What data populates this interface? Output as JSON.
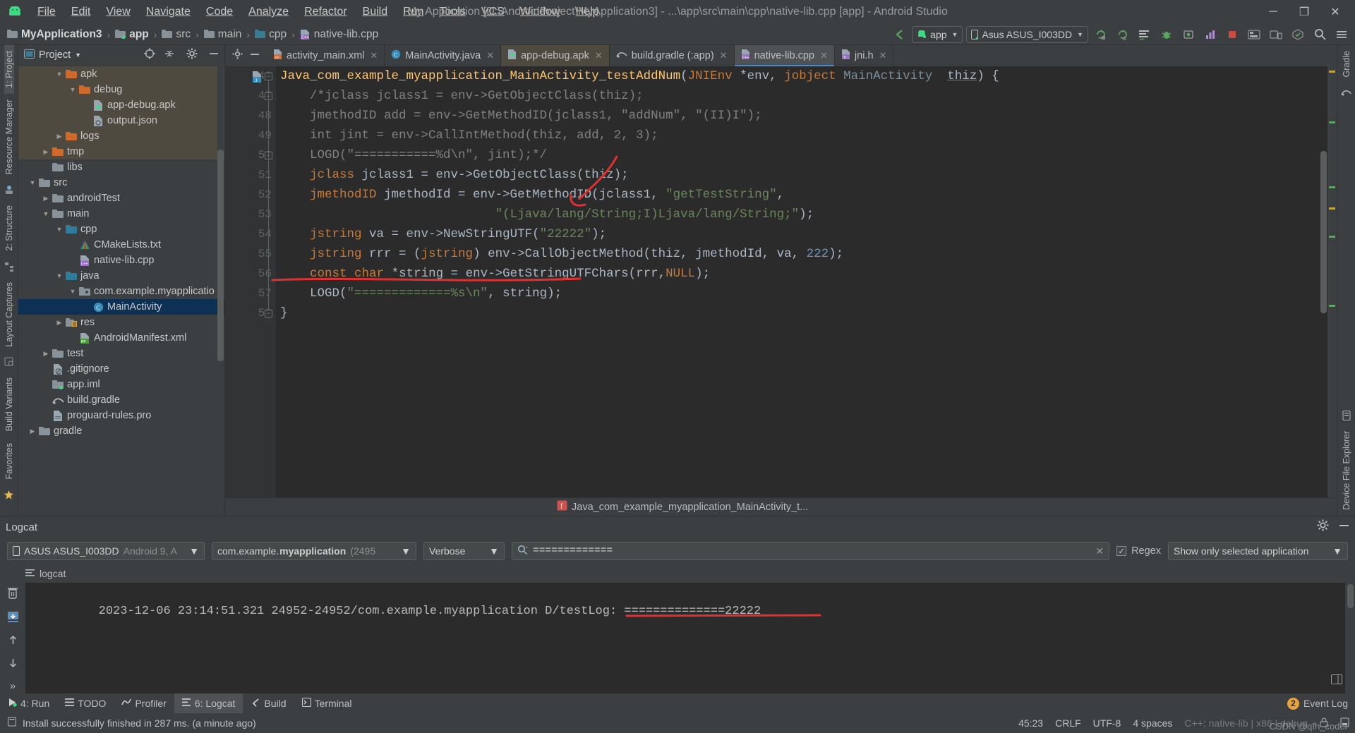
{
  "window": {
    "title": "My Application [D:\\AndroidProject\\MyApplication3] - ...\\app\\src\\main\\cpp\\native-lib.cpp [app] - Android Studio",
    "minimize": "─",
    "maximize": "❐",
    "close": "✕"
  },
  "menu": {
    "items": [
      {
        "label": "File"
      },
      {
        "label": "Edit"
      },
      {
        "label": "View"
      },
      {
        "label": "Navigate"
      },
      {
        "label": "Code"
      },
      {
        "label": "Analyze"
      },
      {
        "label": "Refactor"
      },
      {
        "label": "Build"
      },
      {
        "label": "Run"
      },
      {
        "label": "Tools"
      },
      {
        "label": "VCS"
      },
      {
        "label": "Window"
      },
      {
        "label": "Help"
      }
    ]
  },
  "breadcrumb": {
    "items": [
      "MyApplication3",
      "app",
      "src",
      "main",
      "cpp",
      "native-lib.cpp"
    ],
    "separator": "›"
  },
  "toolbar": {
    "run_config": "app",
    "device": "Asus ASUS_I003DD",
    "icons": [
      "back-arrow-icon",
      "sync-gradle-icon",
      "avd-manager-icon",
      "sdk-manager-icon",
      "run-icon",
      "debug-icon",
      "attach-debugger-icon",
      "profiler-icon",
      "stop-icon",
      "layout-inspector-icon",
      "device-manager-icon",
      "search-icon",
      "menu-icon"
    ]
  },
  "project_panel": {
    "title": "Project",
    "header_icons": [
      "target-icon",
      "collapse-all-icon",
      "gear-icon",
      "hide-icon"
    ],
    "tree": [
      {
        "label": "apk",
        "indent": 4,
        "arrow": "down",
        "icon": "folder-orange-icon",
        "state": "build"
      },
      {
        "label": "debug",
        "indent": 5,
        "arrow": "down",
        "icon": "folder-orange-icon",
        "state": "build"
      },
      {
        "label": "app-debug.apk",
        "indent": 6,
        "arrow": "none",
        "icon": "apk-icon",
        "state": "build"
      },
      {
        "label": "output.json",
        "indent": 6,
        "arrow": "none",
        "icon": "json-icon",
        "state": "build"
      },
      {
        "label": "logs",
        "indent": 4,
        "arrow": "right",
        "icon": "folder-orange-icon",
        "state": "build"
      },
      {
        "label": "tmp",
        "indent": 3,
        "arrow": "right",
        "icon": "folder-orange-icon",
        "state": "build"
      },
      {
        "label": "libs",
        "indent": 3,
        "arrow": "none",
        "icon": "folder-icon",
        "state": "normal"
      },
      {
        "label": "src",
        "indent": 2,
        "arrow": "down",
        "icon": "folder-icon",
        "state": "normal"
      },
      {
        "label": "androidTest",
        "indent": 3,
        "arrow": "right",
        "icon": "folder-icon",
        "state": "normal"
      },
      {
        "label": "main",
        "indent": 3,
        "arrow": "down",
        "icon": "folder-icon",
        "state": "normal"
      },
      {
        "label": "cpp",
        "indent": 4,
        "arrow": "down",
        "icon": "folder-source-icon",
        "state": "normal"
      },
      {
        "label": "CMakeLists.txt",
        "indent": 5,
        "arrow": "none",
        "icon": "cmake-icon",
        "state": "normal"
      },
      {
        "label": "native-lib.cpp",
        "indent": 5,
        "arrow": "none",
        "icon": "cpp-icon",
        "state": "normal"
      },
      {
        "label": "java",
        "indent": 4,
        "arrow": "down",
        "icon": "folder-source-icon",
        "state": "normal"
      },
      {
        "label": "com.example.myapplicatio",
        "indent": 5,
        "arrow": "down",
        "icon": "package-icon",
        "state": "normal"
      },
      {
        "label": "MainActivity",
        "indent": 6,
        "arrow": "none",
        "icon": "class-icon",
        "state": "selected"
      },
      {
        "label": "res",
        "indent": 4,
        "arrow": "right",
        "icon": "folder-res-icon",
        "state": "normal"
      },
      {
        "label": "AndroidManifest.xml",
        "indent": 5,
        "arrow": "none",
        "icon": "manifest-icon",
        "state": "normal"
      },
      {
        "label": "test",
        "indent": 3,
        "arrow": "right",
        "icon": "folder-icon",
        "state": "normal"
      },
      {
        "label": ".gitignore",
        "indent": 3,
        "arrow": "none",
        "icon": "gitignore-icon",
        "state": "normal"
      },
      {
        "label": "app.iml",
        "indent": 3,
        "arrow": "none",
        "icon": "iml-icon",
        "state": "normal"
      },
      {
        "label": "build.gradle",
        "indent": 3,
        "arrow": "none",
        "icon": "gradle-icon",
        "state": "normal"
      },
      {
        "label": "proguard-rules.pro",
        "indent": 3,
        "arrow": "none",
        "icon": "file-icon",
        "state": "normal"
      },
      {
        "label": "gradle",
        "indent": 2,
        "arrow": "right",
        "icon": "folder-icon",
        "state": "normal"
      }
    ]
  },
  "left_rail": {
    "items": [
      "1: Project",
      "Resource Manager",
      "2: Structure",
      "Layout Captures",
      "Build Variants",
      "Favorites"
    ]
  },
  "right_rail": {
    "items": [
      "Gradle",
      "Device File Explorer"
    ]
  },
  "editor": {
    "tabs": [
      {
        "label": "activity_main.xml",
        "icon": "xml-icon",
        "state": "normal"
      },
      {
        "label": "MainActivity.java",
        "icon": "java-icon",
        "state": "normal"
      },
      {
        "label": "app-debug.apk",
        "icon": "apk-icon",
        "state": "build"
      },
      {
        "label": "build.gradle (:app)",
        "icon": "gradle-icon",
        "state": "normal"
      },
      {
        "label": "native-lib.cpp",
        "icon": "cpp-icon",
        "state": "current"
      },
      {
        "label": "jni.h",
        "icon": "h-icon",
        "state": "normal"
      }
    ],
    "first_line_number": 46,
    "lines": [
      {
        "n": 46,
        "text": "Java_com_example_myapplication_MainActivity_testAddNum(JNIEnv *env, jobject MainActivity  thiz) {"
      },
      {
        "n": 47,
        "text": "    /*jclass jclass1 = env->GetObjectClass(thiz);"
      },
      {
        "n": 48,
        "text": "    jmethodID add = env->GetMethodID(jclass1, \"addNum\", \"(II)I\");"
      },
      {
        "n": 49,
        "text": "    int jint = env->CallIntMethod(thiz, add, 2, 3);"
      },
      {
        "n": 50,
        "text": "    LOGD(\"===========%d\\n\", jint);*/"
      },
      {
        "n": 51,
        "text": "    jclass jclass1 = env->GetObjectClass(thiz);"
      },
      {
        "n": 52,
        "text": "    jmethodID jmethodId = env->GetMethodID(jclass1, \"getTestString\","
      },
      {
        "n": 53,
        "text": "                             \"(Ljava/lang/String;I)Ljava/lang/String;\");"
      },
      {
        "n": 54,
        "text": "    jstring va = env->NewStringUTF(\"22222\");"
      },
      {
        "n": 55,
        "text": "    jstring rrr = (jstring) env->CallObjectMethod(thiz, jmethodId, va, 222);"
      },
      {
        "n": 56,
        "text": "    const char *string = env->GetStringUTFChars(rrr,NULL);"
      },
      {
        "n": 57,
        "text": "    LOGD(\"=============%s\\n\", string);"
      },
      {
        "n": 58,
        "text": "}"
      }
    ],
    "breadcrumb_method": "Java_com_example_myapplication_MainActivity_t..."
  },
  "logcat": {
    "title": "Logcat",
    "device": "ASUS ASUS_I003DD",
    "device_suffix": "Android 9, A",
    "process_prefix": "com.example.",
    "process_bold": "myapplication",
    "process_pid": "(2495",
    "level": "Verbose",
    "search_value": "=============",
    "regex_label": "Regex",
    "regex_checked": true,
    "filter": "Show only selected application",
    "tab_label": "logcat",
    "output": "2023-12-06 23:14:51.321 24952-24952/com.example.myapplication D/testLog: ==============22222",
    "side_buttons": [
      "clear-logcat-icon",
      "scroll-to-end-icon",
      "up-icon",
      "down-icon",
      "more-icon"
    ]
  },
  "bottom_tabs": [
    {
      "label": "4: Run",
      "icon": "run-icon",
      "active": false
    },
    {
      "label": "TODO",
      "icon": "todo-icon",
      "active": false
    },
    {
      "label": "Profiler",
      "icon": "profiler-icon",
      "active": false
    },
    {
      "label": "6: Logcat",
      "icon": "logcat-icon",
      "active": true
    },
    {
      "label": "Build",
      "icon": "build-icon",
      "active": false
    },
    {
      "label": "Terminal",
      "icon": "terminal-icon",
      "active": false
    }
  ],
  "event_log": {
    "label": "Event Log",
    "badge": "2"
  },
  "status": {
    "message": "Install successfully finished in 287 ms. (a minute ago)",
    "caret": "45:23",
    "line_sep": "CRLF",
    "encoding": "UTF-8",
    "indent": "4 spaces",
    "context": "C++: native-lib | x86 | debug"
  },
  "watermark": "CSDN @qfh_coder",
  "colors": {
    "accent": "#4a88c7",
    "build_highlight": "#4e4a3f",
    "selection": "#0d3055",
    "annotation_red": "#e03030",
    "editor_bg": "#2b2b2b",
    "panel_bg": "#3c3f41",
    "function_yellow": "#ffc66d",
    "string_green": "#6a8759",
    "keyword_orange": "#cc7832",
    "number_blue": "#6897bb"
  }
}
